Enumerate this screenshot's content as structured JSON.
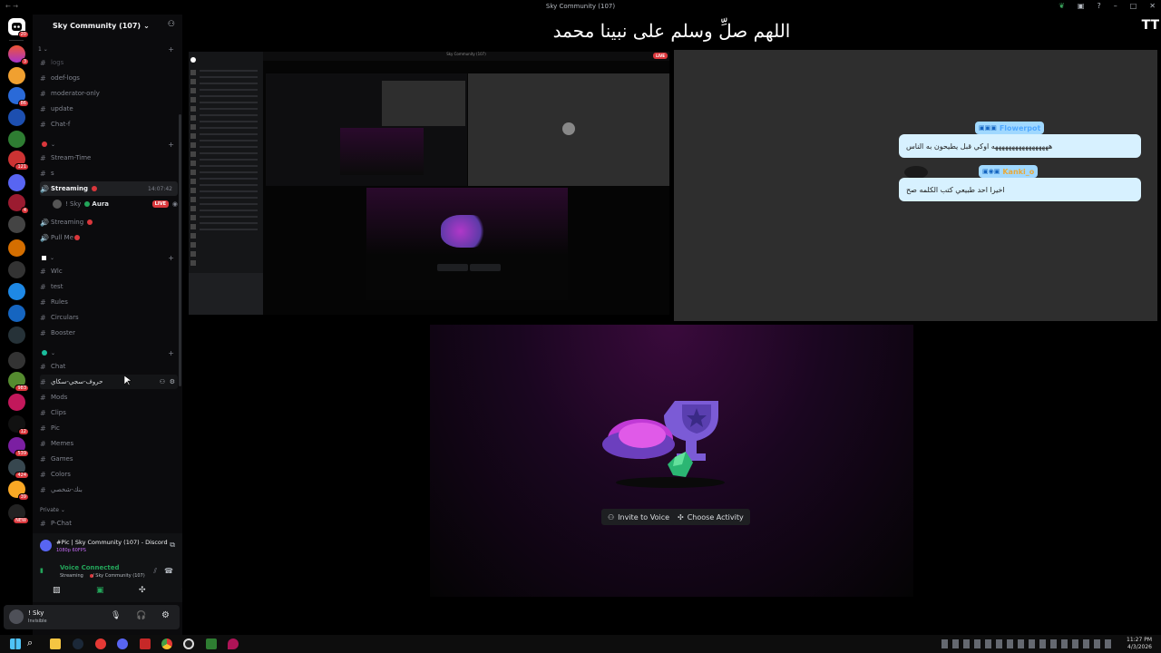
{
  "window": {
    "title": "Sky Community (107)",
    "nav": "← →"
  },
  "rail": {
    "badges": [
      "20",
      "3",
      "86",
      "121",
      "4",
      "983",
      "12",
      "539",
      "424",
      "39",
      "NEW"
    ]
  },
  "server": {
    "name": "Sky Community (107)",
    "chevron": "⌄"
  },
  "categories": {
    "cat1": "1 ⌄",
    "cat2": "⌄",
    "cat3": "⌄",
    "cat4": "⌄",
    "private": "Private ⌄"
  },
  "channels": {
    "logs": "logs",
    "odef_logs": "odef-logs",
    "moderator_only": "moderator-only",
    "update": "update",
    "chat_f": "Chat-f",
    "stream_time": "Stream-Time",
    "s": "s",
    "streaming_voice": "Streaming",
    "streaming_timer": "14:07:42",
    "voice_user": "! Sky",
    "voice_user_tag": "Aura",
    "voice_live": "LIVE",
    "streaming_2": "Streaming",
    "pull_me": "Pull Me",
    "wlc": "Wlc",
    "test": "test",
    "rules": "Rules",
    "circulars": "Circulars",
    "booster": "Booster",
    "chat": "Chat",
    "arabic_ch": "حروف-سجي-سكاي",
    "mods": "Mods",
    "clips": "Clips",
    "pic": "Pic",
    "memes": "Memes",
    "games": "Games",
    "colors": "Colors",
    "arabic_ch2": "بنك-شخصي",
    "p_chat": "P-Chat"
  },
  "activity": {
    "title": "#Pic | Sky Community (107) - Discord",
    "sub": "1080p 60FPS"
  },
  "voice": {
    "status": "Voice Connected",
    "detail": "Streaming",
    "server": "/ Sky Community (107)"
  },
  "user": {
    "name": "! Sky",
    "status": "Invisible"
  },
  "main": {
    "arabic_title": "اللهم صلِّ وسلم على نبينا محمد",
    "tt": "TT",
    "mini_live": "LIVE",
    "mini_title": "Sky Community (107)"
  },
  "chat_overlay": {
    "msg1_name": "Flowerpot",
    "msg1_text": "هههههههههههههههههه اوكي قبل يطيحون به الناس",
    "msg2_name": "Kanki_o",
    "msg2_text": "اخيرا احد طبيعي كتب الكلمه صح",
    "name1_color": "#4fa8ff",
    "name2_color": "#e8a93a"
  },
  "center": {
    "invite_label": "Invite to Voice",
    "activity_label": "Choose Activity"
  },
  "taskbar": {
    "time": "11:27 PM",
    "date": "4/3/2026"
  }
}
